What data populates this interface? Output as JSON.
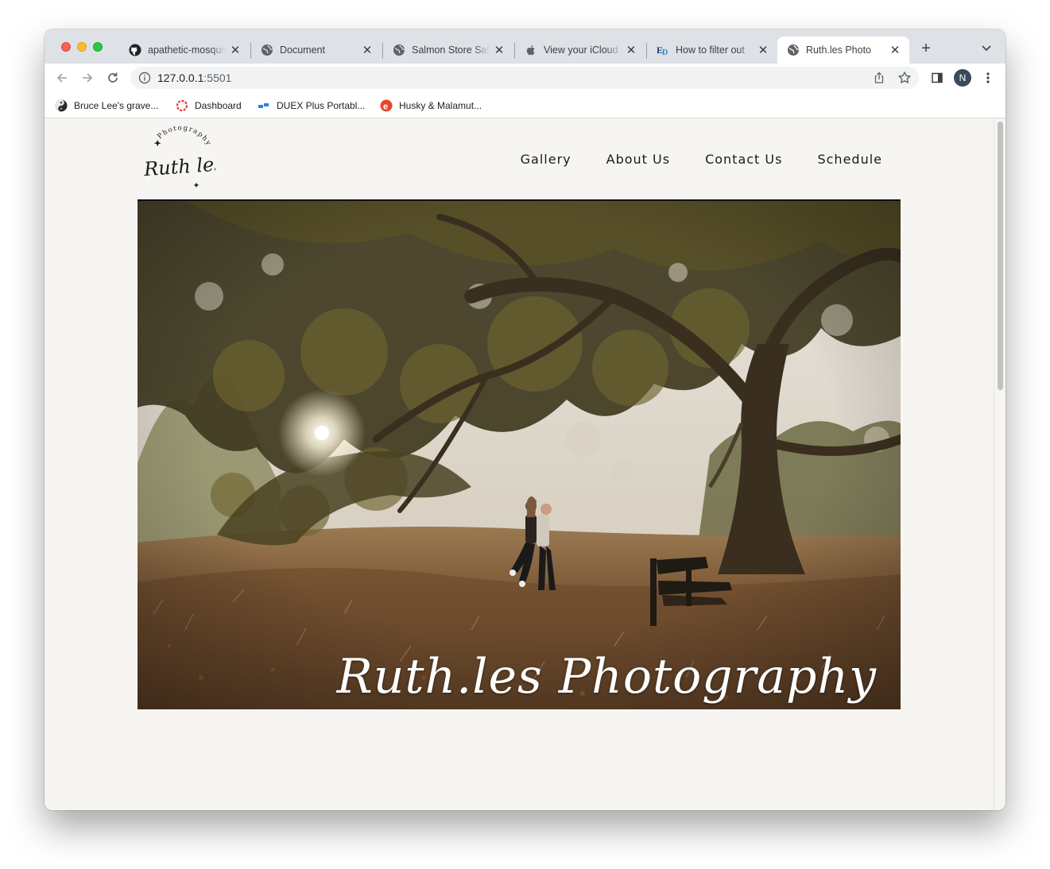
{
  "browser": {
    "tabs": [
      {
        "title": "apathetic-mosquito",
        "icon": "github-icon",
        "active": false
      },
      {
        "title": "Document",
        "icon": "globe-icon",
        "active": false
      },
      {
        "title": "Salmon Store Sale",
        "icon": "globe-icon",
        "active": false
      },
      {
        "title": "View your iCloud",
        "icon": "apple-icon",
        "active": false
      },
      {
        "title": "How to filter out",
        "icon": "ed-icon",
        "active": false
      },
      {
        "title": "Ruth.les Photo",
        "icon": "globe-icon",
        "active": true
      }
    ],
    "url_host": "127.0.0.1",
    "url_port": ":5501",
    "profile_initial": "N",
    "bookmarks": [
      {
        "label": "Bruce Lee's grave...",
        "icon": "yinyang-icon"
      },
      {
        "label": "Dashboard",
        "icon": "dashboard-ring-icon"
      },
      {
        "label": "DUEX Plus Portabl...",
        "icon": "duex-icon"
      },
      {
        "label": "Husky & Malamut...",
        "icon": "e-logo-icon"
      }
    ]
  },
  "site": {
    "logo": {
      "script": "Ruth les",
      "arc": "Photography"
    },
    "nav": [
      "Gallery",
      "About Us",
      "Contact Us",
      "Schedule"
    ],
    "hero_caption": "Ruth.les Photography"
  },
  "colors": {
    "page_bg": "#f7f5f2",
    "header_rule": "#111111",
    "nav_text": "#1b1b1b"
  }
}
